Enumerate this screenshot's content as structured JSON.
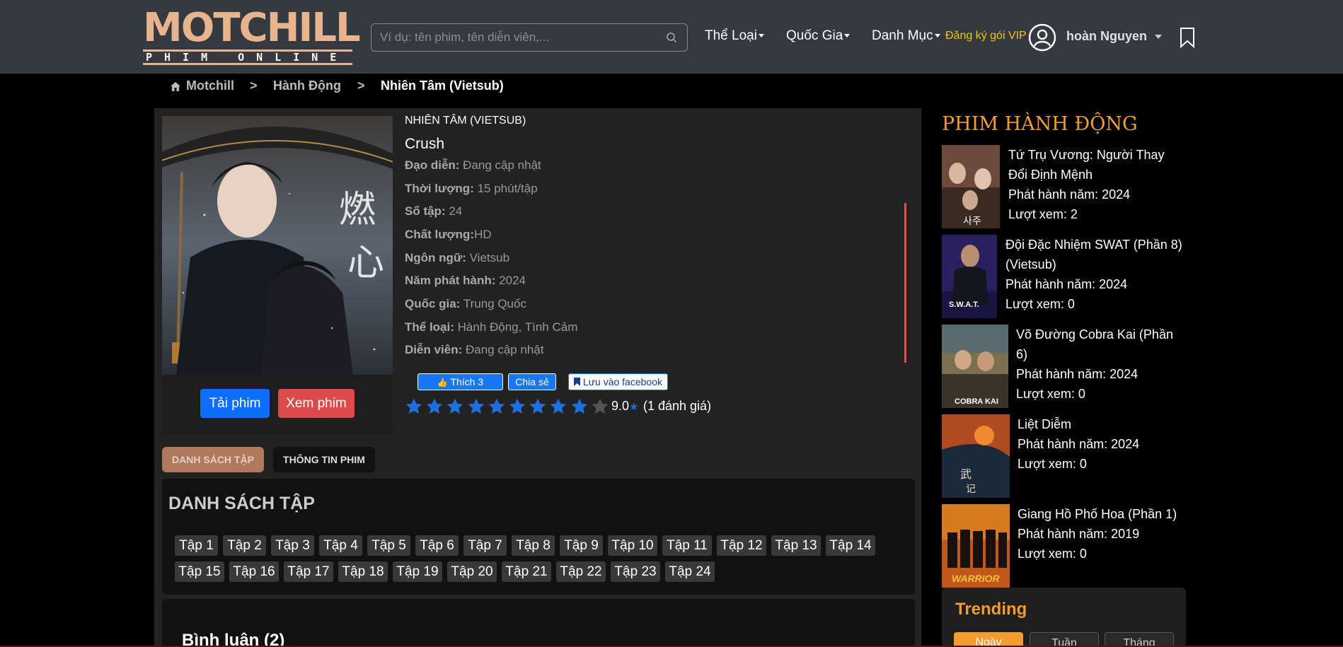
{
  "header": {
    "logo_top": "MOTCHILL",
    "logo_bottom": "PHIM ONLINE",
    "search_placeholder": "Ví dụ: tên phim, tên diễn viên,...",
    "nav": [
      "Thể Loại",
      "Quốc Gia",
      "Danh Mục"
    ],
    "vip_label": "Đăng ký gói VIP",
    "user_name": "hoàn Nguyen"
  },
  "breadcrumb": {
    "home": "Motchill",
    "sep": ">",
    "category": "Hành Động",
    "current": "Nhiên Tâm (Vietsub)"
  },
  "movie": {
    "title_vi": "NHIÊN TÂM (VIETSUB)",
    "title_en": "Crush",
    "details": [
      {
        "label": "Đạo diễn:",
        "value": " Đang cập nhật"
      },
      {
        "label": "Thời lượng:",
        "value": " 15 phút/tập"
      },
      {
        "label": "Số tập:",
        "value": " 24"
      },
      {
        "label": "Chất lượng:",
        "value": "HD"
      },
      {
        "label": "Ngôn ngữ:",
        "value": " Vietsub"
      },
      {
        "label": "Năm phát hành:",
        "value": " 2024"
      },
      {
        "label": "Quốc gia:",
        "value": " Trung Quốc"
      },
      {
        "label": "Thể loại:",
        "value": " Hành Động, Tình Cảm"
      },
      {
        "label": "Diễn viên:",
        "value": " Đang cập nhật"
      }
    ],
    "download_label": "Tải phim",
    "watch_label": "Xem phim",
    "like_label": "Thích 3",
    "share_label": "Chia sẻ",
    "save_fb_label": "Lưu vào facebook",
    "rating_value": "9.0",
    "rating_stars_filled": 9,
    "rating_stars_total": 10,
    "rating_count": "(1 đánh giá)"
  },
  "tabs": {
    "episodes": "DANH SÁCH TẬP",
    "info": "THÔNG TIN PHIM"
  },
  "episodes": {
    "title": "DANH SÁCH TẬP",
    "list": [
      "Tập 1",
      "Tập 2",
      "Tập 3",
      "Tập 4",
      "Tập 5",
      "Tập 6",
      "Tập 7",
      "Tập 8",
      "Tập 9",
      "Tập 10",
      "Tập 11",
      "Tập 12",
      "Tập 13",
      "Tập 14",
      "Tập 15",
      "Tập 16",
      "Tập 17",
      "Tập 18",
      "Tập 19",
      "Tập 20",
      "Tập 21",
      "Tập 22",
      "Tập 23",
      "Tập 24"
    ]
  },
  "comments": {
    "title": "Bình luận (2)"
  },
  "sidebar": {
    "title": "PHIM HÀNH ĐỘNG",
    "items": [
      {
        "title_l1": "Tứ Trụ Vương: Người Thay",
        "title_l2": "Đổi Định Mệnh",
        "year": "Phát hành năm: 2024",
        "views": "Lượt xem: 2"
      },
      {
        "title_l1": "Đội Đặc Nhiệm SWAT (Phần 8)",
        "title_l2": "(Vietsub)",
        "year": "Phát hành năm: 2024",
        "views": "Lượt xem: 0"
      },
      {
        "title_l1": "Võ Đường Cobra Kai (Phần",
        "title_l2": "6)",
        "year": "Phát hành năm: 2024",
        "views": "Lượt xem: 0"
      },
      {
        "title_l1": "Liệt Diễm",
        "title_l2": "",
        "year": "Phát hành năm: 2024",
        "views": "Lượt xem: 0"
      },
      {
        "title_l1": "Giang Hồ Phố Hoa (Phần 1)",
        "title_l2": "",
        "year": "Phát hành năm: 2019",
        "views": "Lượt xem: 0"
      }
    ],
    "trending_title": "Trending",
    "trending_tabs": [
      "Ngày",
      "Tuần",
      "Tháng"
    ]
  },
  "colors": {
    "accent_orange": "#f39c32",
    "primary_blue": "#0d6efd",
    "watch_red": "#dc4b4b",
    "vip_yellow": "#f0c419"
  }
}
